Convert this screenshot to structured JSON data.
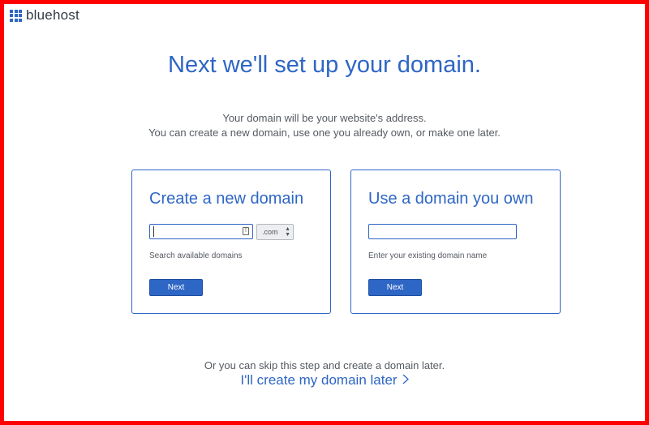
{
  "brand": {
    "name": "bluehost",
    "accent": "#2e66c5",
    "frame_color": "#ff0000"
  },
  "header": {
    "title": "Next we'll set up your domain.",
    "subtitle_line1": "Your domain will be your website's address.",
    "subtitle_line2": "You can create a new domain, use one you already own, or make one later."
  },
  "new_domain": {
    "title": "Create a new domain",
    "input_value": "",
    "tld": ".com",
    "hint": "Search available domains",
    "button": "Next"
  },
  "own_domain": {
    "title": "Use a domain you own",
    "input_value": "",
    "hint": "Enter your existing domain name",
    "button": "Next"
  },
  "footer": {
    "skip_text": "Or you can skip this step and create a domain later.",
    "later_link": "I'll create my domain later",
    "link_icon": "chevron-right-icon"
  }
}
